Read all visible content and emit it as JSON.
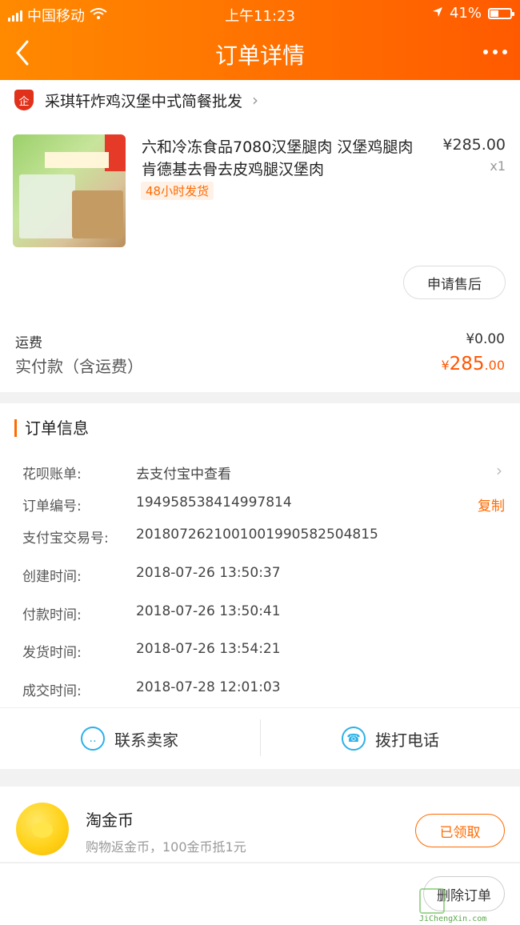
{
  "status": {
    "carrier": "中国移动",
    "time": "上午11:23",
    "battery": "41%",
    "battery_level": 0.41
  },
  "nav": {
    "back": "‹",
    "title": "订单详情"
  },
  "shop": {
    "name": "采琪轩炸鸡汉堡中式简餐批发",
    "icon_text": "企"
  },
  "product": {
    "title": "六和冷冻食品7080汉堡腿肉 汉堡鸡腿肉 肯德基去骨去皮鸡腿汉堡肉",
    "tag": "48小时发货",
    "price": "¥285.00",
    "qty": "x1",
    "after_sale": "申请售后"
  },
  "totals": {
    "freight_label": "运费",
    "freight_value": "¥0.00",
    "paid_label": "实付款（含运费）",
    "paid_currency": "¥",
    "paid_main": "285",
    "paid_decimal": ".00"
  },
  "order_info": {
    "title": "订单信息",
    "rows": [
      {
        "k": "花呗账单:",
        "v": "去支付宝中查看"
      },
      {
        "k": "订单编号:",
        "v": "194958538414997814",
        "action": "复制"
      },
      {
        "k": "支付宝交易号:",
        "v": "2018072621001001990582504815"
      },
      {
        "k": "创建时间:",
        "v": "2018-07-26 13:50:37"
      },
      {
        "k": "付款时间:",
        "v": "2018-07-26 13:50:41"
      },
      {
        "k": "发货时间:",
        "v": "2018-07-26 13:54:21"
      },
      {
        "k": "成交时间:",
        "v": "2018-07-28 12:01:03"
      }
    ]
  },
  "actions": {
    "contact": "联系卖家",
    "call": "拨打电话"
  },
  "coins": {
    "title": "淘金币",
    "subtitle": "购物返金币，100金币抵1元",
    "claimed": "已领取"
  },
  "bottom": {
    "delete": "删除订单"
  },
  "watermark": {
    "url": "JiChengXin.com"
  },
  "colors": {
    "accent": "#ff6a00",
    "header_start": "#ff8a00",
    "header_end": "#ff5a00",
    "icon_blue": "#2bb1e8"
  }
}
